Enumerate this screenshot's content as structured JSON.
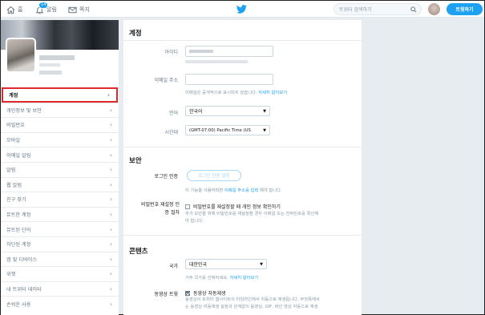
{
  "nav": {
    "home_label": "홈",
    "notifications_label": "알림",
    "notifications_badge": "14",
    "messages_label": "쪽지",
    "search_placeholder": "트위터 검색하기",
    "tweet_button": "트윗하기"
  },
  "icons": {
    "home": "home-icon",
    "notifications": "bell-icon",
    "messages": "envelope-icon",
    "logo": "twitter-bird-icon",
    "search": "search-icon"
  },
  "colors": {
    "accent": "#1da1f2",
    "highlight_border": "#e02a2a"
  },
  "sidebar": {
    "items": [
      {
        "label": "계정",
        "active": true
      },
      {
        "label": "개인정보 및 보안"
      },
      {
        "label": "비밀번호"
      },
      {
        "label": "모바일"
      },
      {
        "label": "이메일 알림"
      },
      {
        "label": "알림"
      },
      {
        "label": "웹 알림"
      },
      {
        "label": "친구 찾기"
      },
      {
        "label": "뮤트한 계정"
      },
      {
        "label": "뮤트된 단어"
      },
      {
        "label": "차단된 계정"
      },
      {
        "label": "앱 및 디바이스"
      },
      {
        "label": "위젯"
      },
      {
        "label": "내 트위터 데이터"
      },
      {
        "label": "손쉬운 사용"
      }
    ],
    "chevron": "›"
  },
  "account": {
    "section_title": "계정",
    "username_label": "아이디",
    "email_label": "이메일 주소",
    "email_help": "이메일은 공개적으로 표시되지 않습니다.",
    "email_help_link": "자세히 알아보기",
    "language_label": "언어",
    "language_value": "한국어",
    "timezone_label": "시간대",
    "timezone_value": "(GMT-07:00) Pacific Time (US"
  },
  "security": {
    "section_title": "보안",
    "login_verification_label": "로그인 인증",
    "login_verification_button": "로그인 인증 설정",
    "login_verification_help": "이 기능을 사용하려면",
    "login_verification_help_link": "이메일 주소를 입력",
    "login_verification_help_tail": "해야 합니다.",
    "password_reset_label_1": "비밀번호 재설정 인",
    "password_reset_label_2": "증 절차",
    "password_reset_checkbox": "비밀번호를 재설정할 때 개인 정보 확인하기",
    "password_reset_checked": false,
    "password_reset_help_1": "추가 보안을 위해 비밀번호를 재설정할 경우 이메일 또는 전화번호를 확인해",
    "password_reset_help_2": "야 합니다."
  },
  "content": {
    "section_title": "콘텐츠",
    "country_label": "국가",
    "country_value": "대한민국",
    "country_help": "거주 국가를 선택하세요.",
    "country_help_link": "자세히 알아보기",
    "video_autoplay_label": "동영상 트윗",
    "video_autoplay_checkbox": "동영상 자동재생",
    "video_autoplay_checked": true,
    "video_help_1": "동영상이 트위터 웹사이트의 타임라인에서 자동으로 재생됩니다. 무엇폭에서",
    "video_help_2": "는 동영상 자동재생 설정과 관계없이 동영상, GIF, 바인 영상 자동으로 재생"
  }
}
